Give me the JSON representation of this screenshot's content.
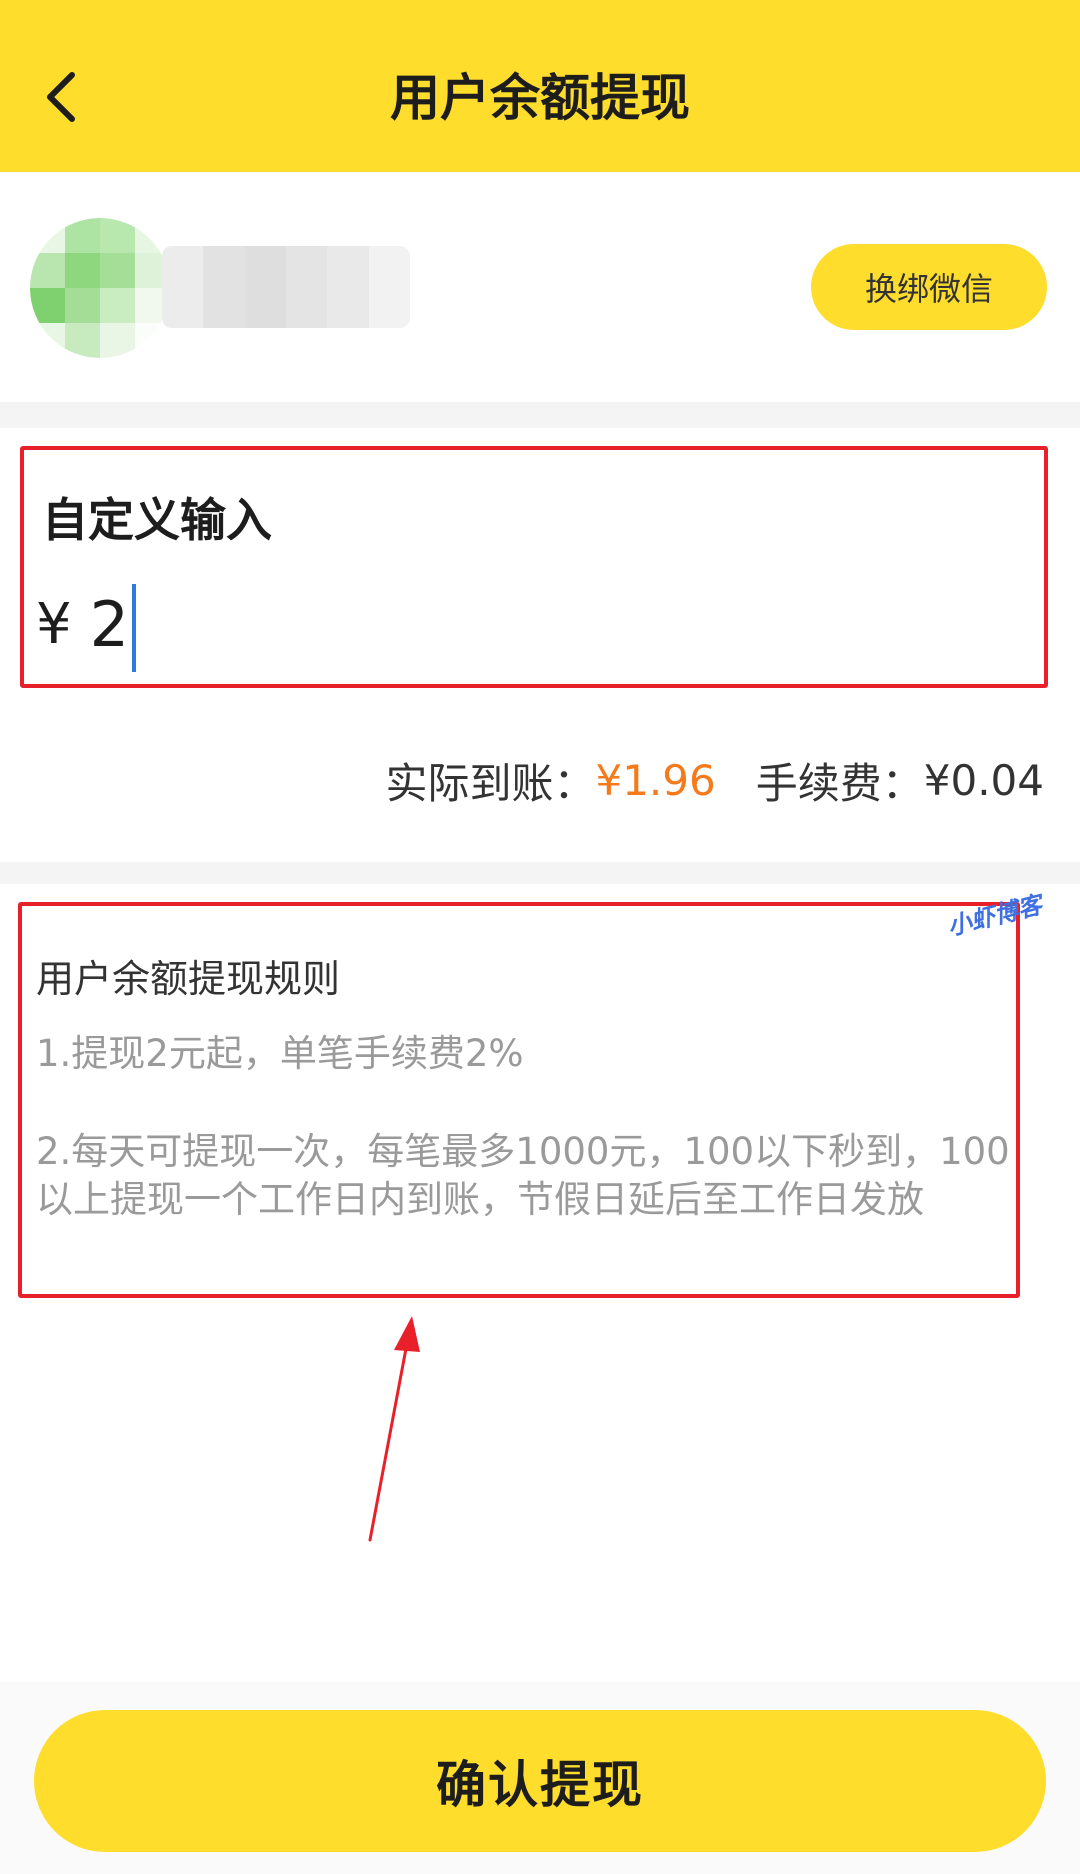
{
  "header": {
    "title": "用户余额提现",
    "back_icon": "chevron-left-icon",
    "background_color": "#ffdd2c"
  },
  "account": {
    "rebind_label": "换绑微信",
    "rebind_color": "#ffdd2c"
  },
  "custom_input": {
    "label": "自定义输入",
    "currency": "¥",
    "value": "2"
  },
  "summary": {
    "actual_label": "实际到账：",
    "actual_value": "¥1.96",
    "actual_color": "#f57a1c",
    "fee_label": "手续费：",
    "fee_value": "¥0.04"
  },
  "rules": {
    "title": "用户余额提现规则",
    "items": [
      "1.提现2元起，单笔手续费2%",
      "2.每天可提现一次，每笔最多1000元，100以下秒到，100以上提现一个工作日内到账，节假日延后至工作日发放"
    ]
  },
  "watermark": "小虾博客",
  "annotation": {
    "highlight_color": "#e8202a",
    "arrow_icon": "red-arrow-icon"
  },
  "footer": {
    "confirm_label": "确认提现"
  }
}
